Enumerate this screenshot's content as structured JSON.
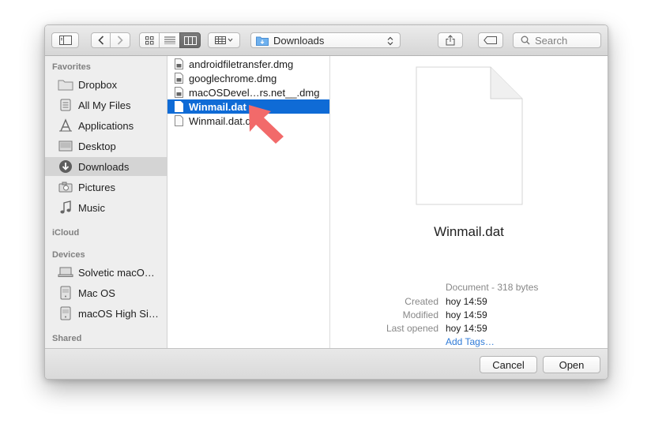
{
  "toolbar": {
    "location": "Downloads",
    "search_placeholder": "Search"
  },
  "sidebar": {
    "favorites_header": "Favorites",
    "favorites": [
      {
        "label": "Dropbox",
        "icon": "folder-icon"
      },
      {
        "label": "All My Files",
        "icon": "all-files-icon"
      },
      {
        "label": "Applications",
        "icon": "applications-icon"
      },
      {
        "label": "Desktop",
        "icon": "desktop-icon"
      },
      {
        "label": "Downloads",
        "icon": "downloads-icon",
        "selected": true
      },
      {
        "label": "Pictures",
        "icon": "camera-icon"
      },
      {
        "label": "Music",
        "icon": "music-note-icon"
      }
    ],
    "icloud_header": "iCloud",
    "devices_header": "Devices",
    "devices": [
      {
        "label": "Solvetic macO…",
        "icon": "computer-icon"
      },
      {
        "label": "Mac OS",
        "icon": "disk-icon"
      },
      {
        "label": "macOS High Si…",
        "icon": "disk-icon"
      }
    ],
    "shared_header": "Shared"
  },
  "files": [
    {
      "name": "androidfiletransfer.dmg",
      "icon": "disk-image-file-icon"
    },
    {
      "name": "googlechrome.dmg",
      "icon": "disk-image-file-icon"
    },
    {
      "name": "macOSDevel…rs.net__.dmg",
      "icon": "disk-image-file-icon"
    },
    {
      "name": "Winmail.dat",
      "icon": "document-file-icon",
      "selected": true
    },
    {
      "name": "Winmail.dat.doc",
      "icon": "document-file-icon"
    }
  ],
  "preview": {
    "filename": "Winmail.dat",
    "kind": "Document - 318 bytes",
    "created_label": "Created",
    "created_value": "hoy 14:59",
    "modified_label": "Modified",
    "modified_value": "hoy 14:59",
    "last_opened_label": "Last opened",
    "last_opened_value": "hoy 14:59",
    "add_tags": "Add Tags…"
  },
  "buttons": {
    "cancel": "Cancel",
    "open": "Open"
  },
  "colors": {
    "selection": "#0f6bd6",
    "annotation_arrow": "#f26a6a",
    "link": "#2f7bd8"
  }
}
